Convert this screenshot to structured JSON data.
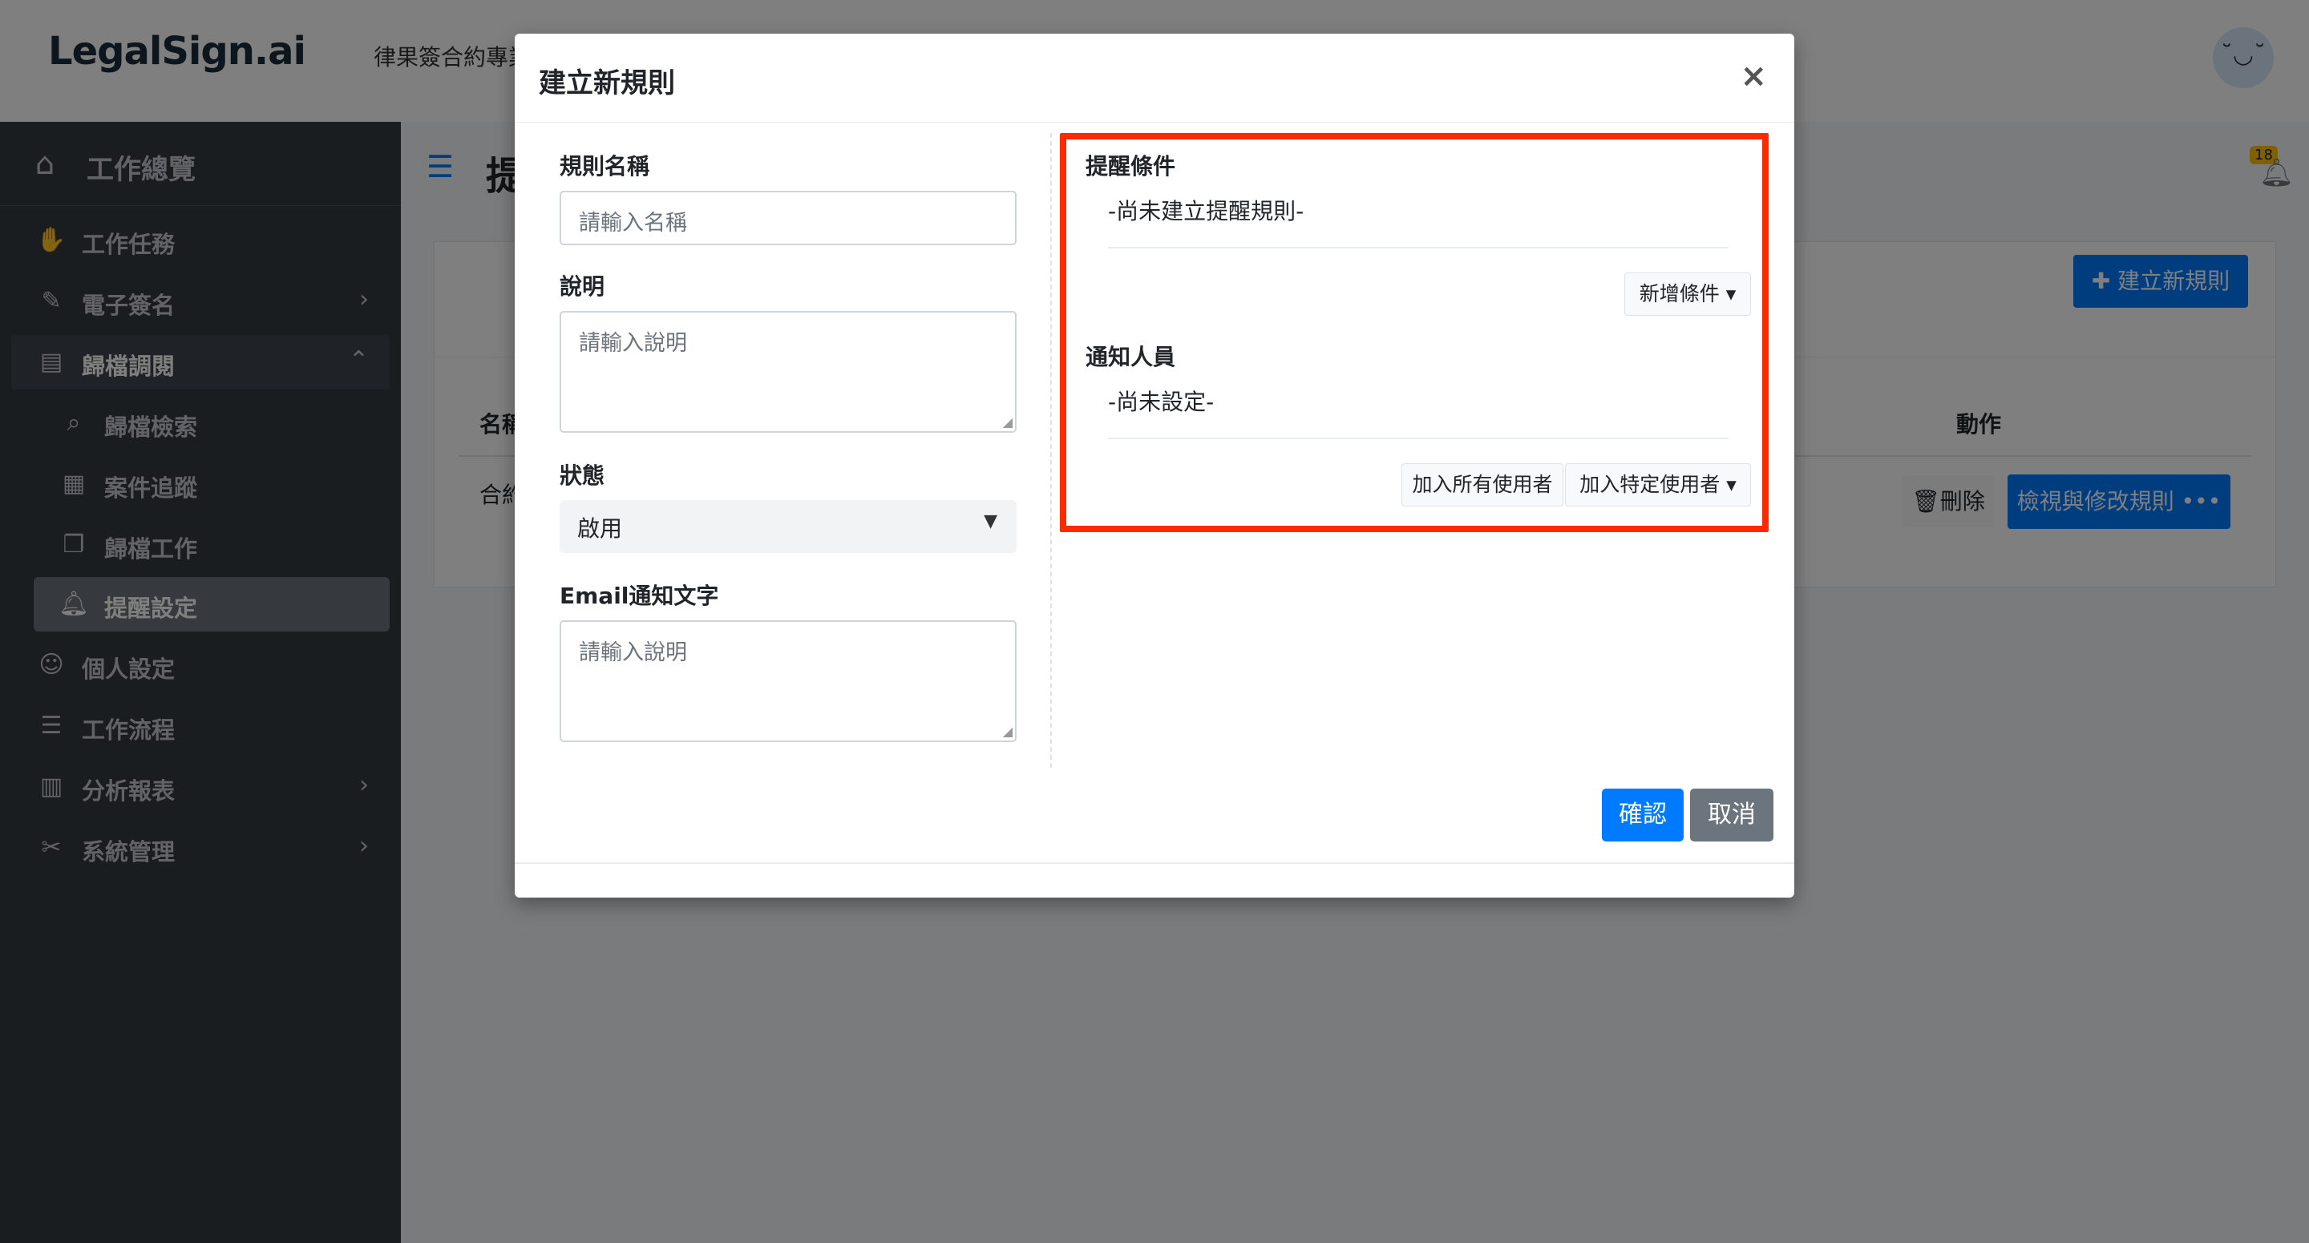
{
  "topbar": {
    "logo": "LegalSign.ai",
    "tagline": "律果簽合約專業",
    "avatar_face": "˘◡˘"
  },
  "sidebar": {
    "header": {
      "icon": "home-icon",
      "label": "工作總覽"
    },
    "items": [
      {
        "label": "工作任務",
        "icon": "handshake-icon"
      },
      {
        "label": "電子簽名",
        "icon": "signature-icon",
        "chevron": "›"
      },
      {
        "label": "歸檔調閱",
        "icon": "archive-icon",
        "chevron": "⌃"
      },
      {
        "label": "歸檔檢索",
        "icon": "search-plus-icon"
      },
      {
        "label": "案件追蹤",
        "icon": "calendar-check-icon"
      },
      {
        "label": "歸檔工作",
        "icon": "copy-icon"
      },
      {
        "label": "提醒設定",
        "icon": "bell-icon"
      },
      {
        "label": "個人設定",
        "icon": "user-cog-icon"
      },
      {
        "label": "工作流程",
        "icon": "tasks-icon"
      },
      {
        "label": "分析報表",
        "icon": "chart-bar-icon",
        "chevron": "›"
      },
      {
        "label": "系統管理",
        "icon": "tools-icon",
        "chevron": "›"
      }
    ]
  },
  "page": {
    "title_fragment": "提",
    "bell_badge": "18",
    "create_button": "✚ 建立新規則",
    "table": {
      "col_name": "名稱",
      "col_action": "動作",
      "row_name_fragment": "合約",
      "delete_button": "🗑刪除",
      "view_button": "檢視與修改規則 •••"
    }
  },
  "modal": {
    "title": "建立新規則",
    "close": "×",
    "rule_name_label": "規則名稱",
    "rule_name_placeholder": "請輸入名稱",
    "desc_label": "說明",
    "desc_placeholder": "請輸入說明",
    "status_label": "狀態",
    "status_value": "啟用",
    "email_label": "Email通知文字",
    "email_placeholder": "請輸入說明",
    "conditions": {
      "title": "提醒條件",
      "empty": "-尚未建立提醒規則-",
      "add_button": "新增條件 ▾"
    },
    "notify": {
      "title": "通知人員",
      "empty": "-尚未設定-",
      "add_all_button": "加入所有使用者",
      "add_specific_button": "加入特定使用者 ▾"
    },
    "confirm_button": "確認",
    "cancel_button": "取消"
  },
  "colors": {
    "primary": "#007bff",
    "secondary": "#6c757d",
    "sidebar": "#343a40",
    "highlight": "#ff2a00"
  }
}
